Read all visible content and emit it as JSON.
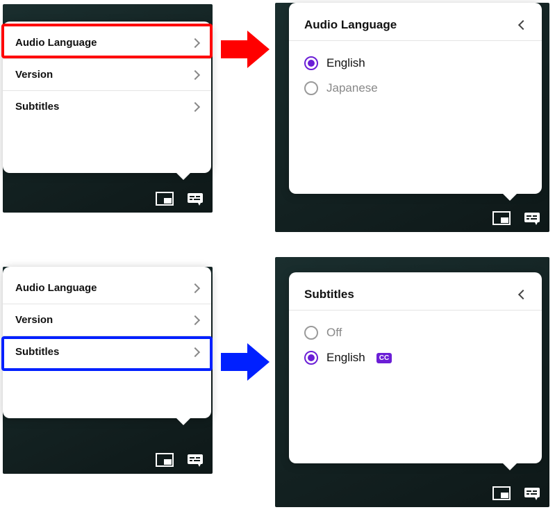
{
  "menu": {
    "items": [
      {
        "label": "Audio Language"
      },
      {
        "label": "Version"
      },
      {
        "label": "Subtitles"
      }
    ]
  },
  "audioLanguage": {
    "title": "Audio Language",
    "options": [
      {
        "label": "English",
        "selected": true
      },
      {
        "label": "Japanese",
        "selected": false
      }
    ]
  },
  "subtitles": {
    "title": "Subtitles",
    "options": [
      {
        "label": "Off",
        "selected": false
      },
      {
        "label": "English",
        "selected": true,
        "cc": true
      }
    ],
    "cc_badge": "CC"
  },
  "colors": {
    "accent": "#6b1ed6",
    "highlight_red": "#ff0000",
    "highlight_blue": "#0020ff"
  }
}
